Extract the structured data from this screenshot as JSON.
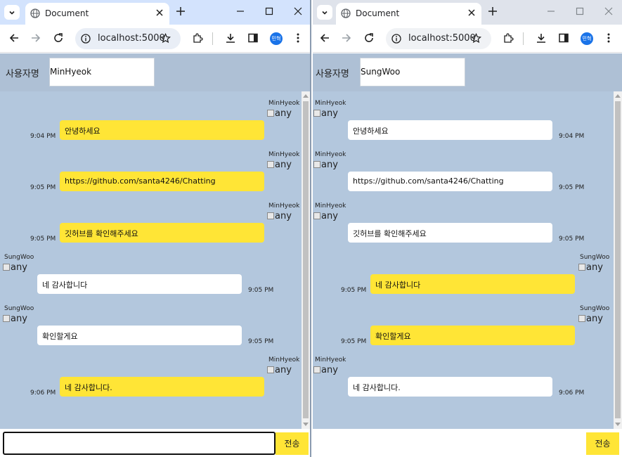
{
  "left": {
    "tab_title": "Document",
    "url": "localhost:5000",
    "profile_label": "민혁",
    "username_label": "사용자명",
    "username_value": "MinHyeok",
    "send_label": "전송",
    "input_value": "",
    "messages": [
      {
        "side": "mine",
        "name": "MinHyeok",
        "avatar_alt": "any",
        "text": "안녕하세요",
        "time": "9:04 PM"
      },
      {
        "side": "mine",
        "name": "MinHyeok",
        "avatar_alt": "any",
        "text": "https://github.com/santa4246/Chatting",
        "time": "9:05 PM"
      },
      {
        "side": "mine",
        "name": "MinHyeok",
        "avatar_alt": "any",
        "text": "깃허브를 확인해주세요",
        "time": "9:05 PM"
      },
      {
        "side": "other",
        "name": "SungWoo",
        "avatar_alt": "any",
        "text": "네 감사합니다",
        "time": "9:05 PM"
      },
      {
        "side": "other",
        "name": "SungWoo",
        "avatar_alt": "any",
        "text": "확인할게요",
        "time": "9:05 PM"
      },
      {
        "side": "mine",
        "name": "MinHyeok",
        "avatar_alt": "any",
        "text": "네 감사합니다.",
        "time": "9:06 PM"
      }
    ]
  },
  "right": {
    "tab_title": "Document",
    "url": "localhost:5000",
    "username_label": "사용자명",
    "username_value": "SungWoo",
    "send_label": "전송",
    "messages": [
      {
        "side": "other",
        "name": "MinHyeok",
        "avatar_alt": "any",
        "text": "안녕하세요",
        "time": "9:04 PM"
      },
      {
        "side": "other",
        "name": "MinHyeok",
        "avatar_alt": "any",
        "text": "https://github.com/santa4246/Chatting",
        "time": "9:05 PM"
      },
      {
        "side": "other",
        "name": "MinHyeok",
        "avatar_alt": "any",
        "text": "깃허브를 확인해주세요",
        "time": "9:05 PM"
      },
      {
        "side": "mine",
        "name": "SungWoo",
        "avatar_alt": "any",
        "text": "네 감사합니다",
        "time": "9:05 PM"
      },
      {
        "side": "mine",
        "name": "SungWoo",
        "avatar_alt": "any",
        "text": "확인할게요",
        "time": "9:05 PM"
      },
      {
        "side": "other",
        "name": "MinHyeok",
        "avatar_alt": "any",
        "text": "네 감사합니다.",
        "time": "9:06 PM"
      }
    ]
  },
  "colors": {
    "tabstrip_active": "#d3e3fd",
    "tabstrip_inactive": "#dfe3eb",
    "chat_background": "#b3c7dd",
    "my_bubble": "#ffe536",
    "other_bubble": "#ffffff",
    "send_button": "#ffe536"
  },
  "icons": [
    "tab-search-icon",
    "globe-icon",
    "close-icon",
    "plus-icon",
    "minimize-icon",
    "maximize-icon",
    "back-icon",
    "forward-icon",
    "reload-icon",
    "info-icon",
    "star-icon",
    "extensions-icon",
    "download-icon",
    "side-panel-icon",
    "menu-icon",
    "broken-image-icon"
  ]
}
